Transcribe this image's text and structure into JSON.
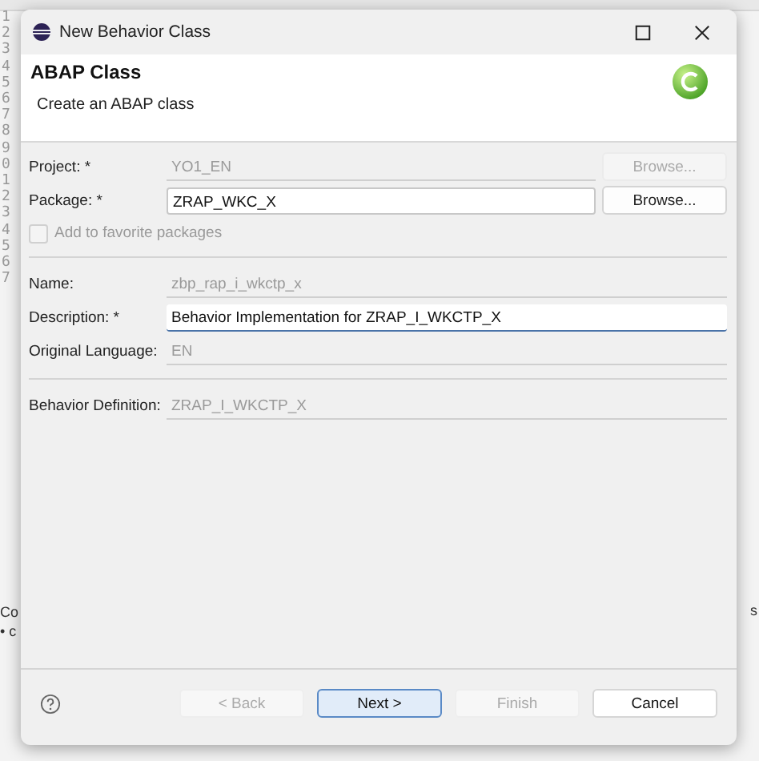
{
  "background": {
    "line_numbers": [
      "1",
      "2",
      "3",
      "4",
      "5",
      "6",
      "7",
      "8",
      "9",
      "0",
      "1",
      "2",
      "3",
      "4",
      "5",
      "6",
      "7"
    ],
    "bottom_left": [
      "Co",
      "• c"
    ],
    "bottom_right": "s"
  },
  "window": {
    "title": "New Behavior Class"
  },
  "header": {
    "title": "ABAP Class",
    "subtitle": "Create an ABAP class"
  },
  "sections": [
    [
      {
        "label": "Project: *",
        "value": "YO1_EN",
        "disabled": true,
        "browse": {
          "label": "Browse...",
          "disabled": true
        }
      },
      {
        "label": "Package: *",
        "value": "ZRAP_WKC_X",
        "disabled": false,
        "browse": {
          "label": "Browse...",
          "disabled": false
        }
      },
      {
        "kind": "checkbox",
        "label": "Add to favorite packages",
        "checked": false,
        "disabled": true
      }
    ],
    [
      {
        "label": "Name:",
        "value": "zbp_rap_i_wkctp_x",
        "disabled": true
      },
      {
        "label": "Description: *",
        "value": "Behavior Implementation for ZRAP_I_WKCTP_X",
        "disabled": false,
        "focused": true
      },
      {
        "label": "Original Language:",
        "value": "EN",
        "disabled": true
      }
    ],
    [
      {
        "label": "Behavior Definition:",
        "value": "ZRAP_I_WKCTP_X",
        "disabled": true
      }
    ]
  ],
  "buttons": [
    {
      "label": "< Back",
      "disabled": true,
      "default": false
    },
    {
      "label": "Next >",
      "disabled": false,
      "default": true
    },
    {
      "label": "Finish",
      "disabled": true,
      "default": false
    },
    {
      "label": "Cancel",
      "disabled": false,
      "default": false
    }
  ]
}
